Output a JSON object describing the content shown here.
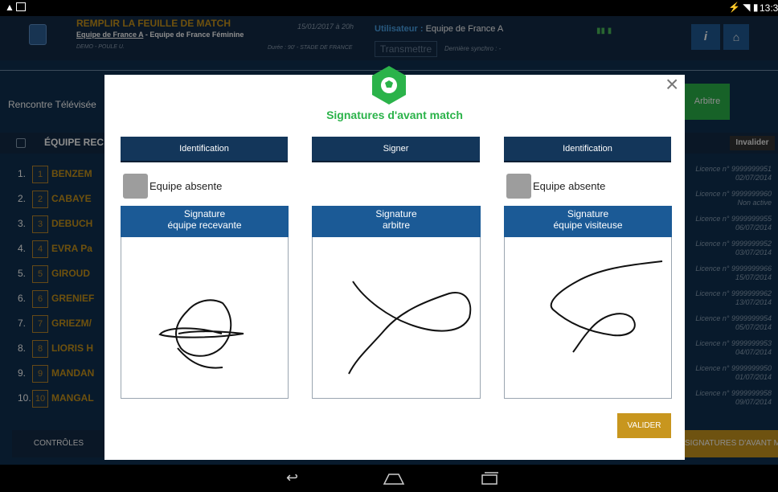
{
  "statusbar": {
    "time": "13:3"
  },
  "header": {
    "title": "REMPLIR LA FEUILLE DE MATCH",
    "teams_home": "Equipe de France A",
    "teams_sep": " - ",
    "teams_away": "Equipe de France Féminine",
    "competition": "DEMO - POULE U.",
    "datetime": "15/01/2017 à 20h",
    "duration_stadium": "Durée : 90' - STADE DE FRANCE",
    "user_label": "Utilisateur :",
    "user_value": " Equipe de France A",
    "transmit_button": "Transmettre",
    "last_sync": "Dernière synchro : -",
    "info_button": "i"
  },
  "background": {
    "rencontre": "Rencontre Télévisée",
    "arbitre_button": "Arbitre",
    "team_home_label": "ÉQUIPE REC",
    "invalidate_button": "Invalider",
    "controls_button": "CONTRÔLES",
    "signatures_button": "SIGNATURES D'AVANT MATCH",
    "players": [
      {
        "n": "1.",
        "num": "1",
        "name": "BENZEM",
        "lic": "Licence n° 9999999951",
        "date": "02/07/2014"
      },
      {
        "n": "2.",
        "num": "2",
        "name": "CABAYE",
        "lic": "Licence n° 9999999960",
        "date": "Non active"
      },
      {
        "n": "3.",
        "num": "3",
        "name": "DEBUCH",
        "lic": "Licence n° 9999999955",
        "date": "06/07/2014"
      },
      {
        "n": "4.",
        "num": "4",
        "name": "EVRA Pa",
        "lic": "Licence n° 9999999952",
        "date": "03/07/2014"
      },
      {
        "n": "5.",
        "num": "5",
        "name": "GIROUD",
        "lic": "Licence n° 9999999966",
        "date": "15/07/2014"
      },
      {
        "n": "6.",
        "num": "6",
        "name": "GRENIEF",
        "lic": "Licence n° 9999999962",
        "date": "13/07/2014"
      },
      {
        "n": "7.",
        "num": "7",
        "name": "GRIEZM/",
        "lic": "Licence n° 9999999954",
        "date": "05/07/2014"
      },
      {
        "n": "8.",
        "num": "8",
        "name": "LIORIS H",
        "lic": "Licence n° 9999999953",
        "date": "04/07/2014"
      },
      {
        "n": "9.",
        "num": "9",
        "name": "MANDAN",
        "lic": "Licence n° 9999999950",
        "date": "01/07/2014"
      },
      {
        "n": "10.",
        "num": "10",
        "name": "MANGAL",
        "lic": "Licence n° 9999999958",
        "date": "09/07/2014"
      }
    ]
  },
  "modal": {
    "title": "Signatures d'avant match",
    "close_icon": "×",
    "columns": [
      {
        "header": "Identification",
        "absent_label": "Equipe absente",
        "sig_line1": "Signature",
        "sig_line2": "équipe recevante"
      },
      {
        "header": "Signer",
        "absent_label": "",
        "sig_line1": "Signature",
        "sig_line2": "arbitre"
      },
      {
        "header": "Identification",
        "absent_label": "Equipe absente",
        "sig_line1": "Signature",
        "sig_line2": "équipe visiteuse"
      }
    ],
    "validate_button": "VALIDER"
  },
  "colors": {
    "accent": "#2bb34a",
    "gold": "#c8961e",
    "navy": "#13365a",
    "blue": "#1b5a96"
  }
}
